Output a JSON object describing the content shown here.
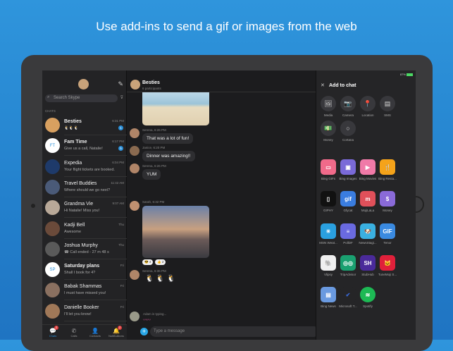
{
  "headline": "Use add-ins to send a gif or images from the web",
  "sidebar": {
    "search_placeholder": "Search Skype",
    "section": "CHATS",
    "chats": [
      {
        "name": "Besties",
        "preview": "🐧🐧🐧",
        "time": "6:31 PM",
        "badge": "1",
        "bold": true,
        "initials": ""
      },
      {
        "name": "Fam Time",
        "preview": "Give us a call, Natalie!",
        "time": "6:17 PM",
        "badge": "5",
        "bold": true,
        "initials": "FT"
      },
      {
        "name": "Expedia",
        "preview": "Your flight tickets are booked.",
        "time": "6:04 PM",
        "badge": "",
        "bold": false,
        "initials": ""
      },
      {
        "name": "Travel Buddies",
        "preview": "Where should we go next?",
        "time": "11:42 AM",
        "badge": "",
        "bold": false,
        "initials": ""
      },
      {
        "name": "Grandma Vie",
        "preview": "Hi Natalie! Miss you!",
        "time": "9:07 AM",
        "badge": "",
        "bold": false,
        "initials": ""
      },
      {
        "name": "Kadji Bell",
        "preview": "Awesome",
        "time": "Thu",
        "badge": "",
        "bold": false,
        "initials": ""
      },
      {
        "name": "Joshua Murphy",
        "preview": "☎ Call ended - 27 m 48 s",
        "time": "Thu",
        "badge": "",
        "bold": false,
        "initials": ""
      },
      {
        "name": "Saturday plans",
        "preview": "Shall I book for 4?",
        "time": "Fri",
        "badge": "",
        "bold": true,
        "initials": "SP"
      },
      {
        "name": "Babak Shammas",
        "preview": "I must have missed you!",
        "time": "Fri",
        "badge": "",
        "bold": false,
        "initials": ""
      },
      {
        "name": "Danielle Booker",
        "preview": "I'll let you know!",
        "time": "Fri",
        "badge": "",
        "bold": false,
        "initials": ""
      }
    ],
    "tabs": [
      {
        "label": "Chats",
        "icon": "💬",
        "badge": "2"
      },
      {
        "label": "Calls",
        "icon": "✆",
        "badge": ""
      },
      {
        "label": "Contacts",
        "icon": "👤",
        "badge": ""
      },
      {
        "label": "Notifications",
        "icon": "🔔",
        "badge": "2"
      }
    ]
  },
  "chat": {
    "title": "Besties",
    "subtitle": "6 participants",
    "messages": [
      {
        "meta": "Serena, 6:26 PM",
        "text": "That was a lot of fun!"
      },
      {
        "meta": "Janice, 6:20 PM",
        "text": "Dinner was amazing!!"
      },
      {
        "meta": "Serena, 6:26 PM",
        "text": "YUM"
      },
      {
        "meta": "Sarah, 6:32 PM",
        "text": ""
      },
      {
        "meta": "Serena, 6:36 PM",
        "text": "🐧 🐧 🐧"
      }
    ],
    "reactions": [
      "😎 4",
      "👍 2"
    ],
    "typing": "Adam is typing...",
    "input_placeholder": "Type a message"
  },
  "panel": {
    "status": "87%",
    "title": "Add to chat",
    "actions": [
      {
        "label": "Media",
        "icon": "🖼"
      },
      {
        "label": "Camera",
        "icon": "📷"
      },
      {
        "label": "Location",
        "icon": "📍"
      },
      {
        "label": "SMS",
        "icon": "▤"
      },
      {
        "label": "Money",
        "icon": "💵"
      },
      {
        "label": "Cortana",
        "icon": "○"
      }
    ],
    "apps": [
      {
        "label": "Bing GIFs",
        "glyph": "▭",
        "color": "#f06a8a"
      },
      {
        "label": "Bing Images",
        "glyph": "▣",
        "color": "#7a6ad8"
      },
      {
        "label": "Bing Movies",
        "glyph": "▶",
        "color": "#f07aa8"
      },
      {
        "label": "Bing Resta...",
        "glyph": "🍴",
        "color": "#f5a31a"
      },
      {
        "label": "GIPHY",
        "glyph": "▯",
        "color": "#111111"
      },
      {
        "label": "Gfycat",
        "glyph": "gif",
        "color": "#3a7de0"
      },
      {
        "label": "MojiLaLa",
        "glyph": "m",
        "color": "#e0505a"
      },
      {
        "label": "Money",
        "glyph": "$",
        "color": "#8a6ad8"
      },
      {
        "label": "MSN Weat...",
        "glyph": "☀",
        "color": "#2aa0e0"
      },
      {
        "label": "PollDF",
        "glyph": "≡",
        "color": "#6a6ae0"
      },
      {
        "label": "NewsStagi...",
        "glyph": "🐶",
        "color": "#3ab0e0"
      },
      {
        "label": "Tenor",
        "glyph": "GIF",
        "color": "#3a8ae0"
      },
      {
        "label": "Vlipsy",
        "glyph": "🐘",
        "color": "#f0f0f0"
      },
      {
        "label": "TripAdvisor",
        "glyph": "◎◎",
        "color": "#1aa070"
      },
      {
        "label": "StubHub",
        "glyph": "SH",
        "color": "#4a2a9a"
      },
      {
        "label": "TuneMoji S...",
        "glyph": "🐱",
        "color": "#e0203a"
      },
      {
        "label": "Bing News",
        "glyph": "▤",
        "color": "#6a9ae0"
      },
      {
        "label": "Microsoft T...",
        "glyph": "✔",
        "color": "#252527"
      },
      {
        "label": "Spotify",
        "glyph": "≋",
        "color": "#1db954"
      }
    ]
  }
}
